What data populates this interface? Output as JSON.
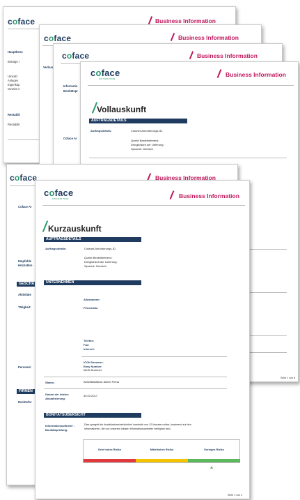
{
  "brand": {
    "logo_c": "c",
    "logo_o": "o",
    "logo_rest": "face",
    "tagline": "FOR SAFER TRADE",
    "business_information": "Business Information"
  },
  "colors": {
    "navy": "#1f3c60",
    "magenta": "#c0185d",
    "green": "#2a9a6b",
    "risk_high": "#e03a3e",
    "risk_medium": "#f5c400",
    "risk_low": "#5cb85c"
  },
  "back_top": {
    "p1": {
      "hauptkennzahlen": "Hauptkenn",
      "betraege": "Beträge i",
      "umsatz": "Umsatz",
      "anlagev": "Anlagev",
      "eigenkap": "Eigenkap",
      "gewinn": "Gewinn n",
      "rentabil": "Rentabili",
      "rentabilit": "Rentabilit"
    },
    "p2": {
      "verbund": "Verbun"
    },
    "p3": {
      "information": "Informatio",
      "bonitaet": "Bonitätspr",
      "coface": "Coface Ar"
    },
    "p4": {
      "title": "Vollauskunft",
      "section": "AUFTRAGSDETAILS",
      "label": "Auftragsdetails:",
      "lines": [
        "Cofanet-Anforderungs-ID:",
        "Quelle Bestellreferenz:",
        "Dringlichkeit der Lieferung:",
        "Sprache: Deutsch"
      ],
      "footer": "Seite 1 von 8"
    }
  },
  "back_bottom": {
    "coface_ar": "Coface Ar",
    "empfohlen": "Empfohle",
    "hoechstkr": "Höchstkre",
    "geschae": "GESCHÄ",
    "aktivitaet": "Aktivitäte",
    "taetigkeit": "Tätigkeit:",
    "personal": "Personal:",
    "firmen": "FIRMEN",
    "rechtsfor": "Rechtsfor"
  },
  "front": {
    "title": "Kurzauskunft",
    "auftrag": {
      "section": "AUFTRAGSDETAILS",
      "label": "Auftragsdetails:",
      "lines": [
        "Cofanet-Anforderungs-ID:",
        "Quelle Bestellreferenz:",
        "Dringlichkeit der Lieferung:",
        "Sprache: Deutsch"
      ]
    },
    "unternehmen": {
      "section": "UNTERNEHMEN",
      "aliasnamen": "Aliasnamen:",
      "firmensitz": "Firmensitz:",
      "telefon": "Telefon:",
      "fax": "Fax:",
      "internet": "Internet:",
      "icon_nummer": "ICON Nummer:",
      "easy_number": "Easy Number:",
      "messt_nummer": "MeSt-Nummer:",
      "status_label": "Status:",
      "status_value": "Aktivitätsstatus: Aktive Firma",
      "datum_label_1": "Datum der letzten",
      "datum_label_2": "Aktualisierung:",
      "datum_value": "30.03.2017"
    },
    "bonitaet": {
      "section": "BONITÄTSÜBERSICHT",
      "label_1": "Informationsanbieter -",
      "label_2": "Bonitätsprüfung:",
      "text_1": "Dies spiegelt die Ausfallwahrscheinlichkeit innerhalb von 12 Monaten wider, basierend auf den",
      "text_2": "Informationen, die von unserem lokalen Informationsanbieter verfügbar sind.",
      "risk_high": "Sehr hohes Risiko",
      "risk_medium": "Mittelhohes Risiko",
      "risk_low": "Geringes Risiko",
      "selected": "Geringes Risiko"
    },
    "footer": "Seite 1 von 4"
  }
}
